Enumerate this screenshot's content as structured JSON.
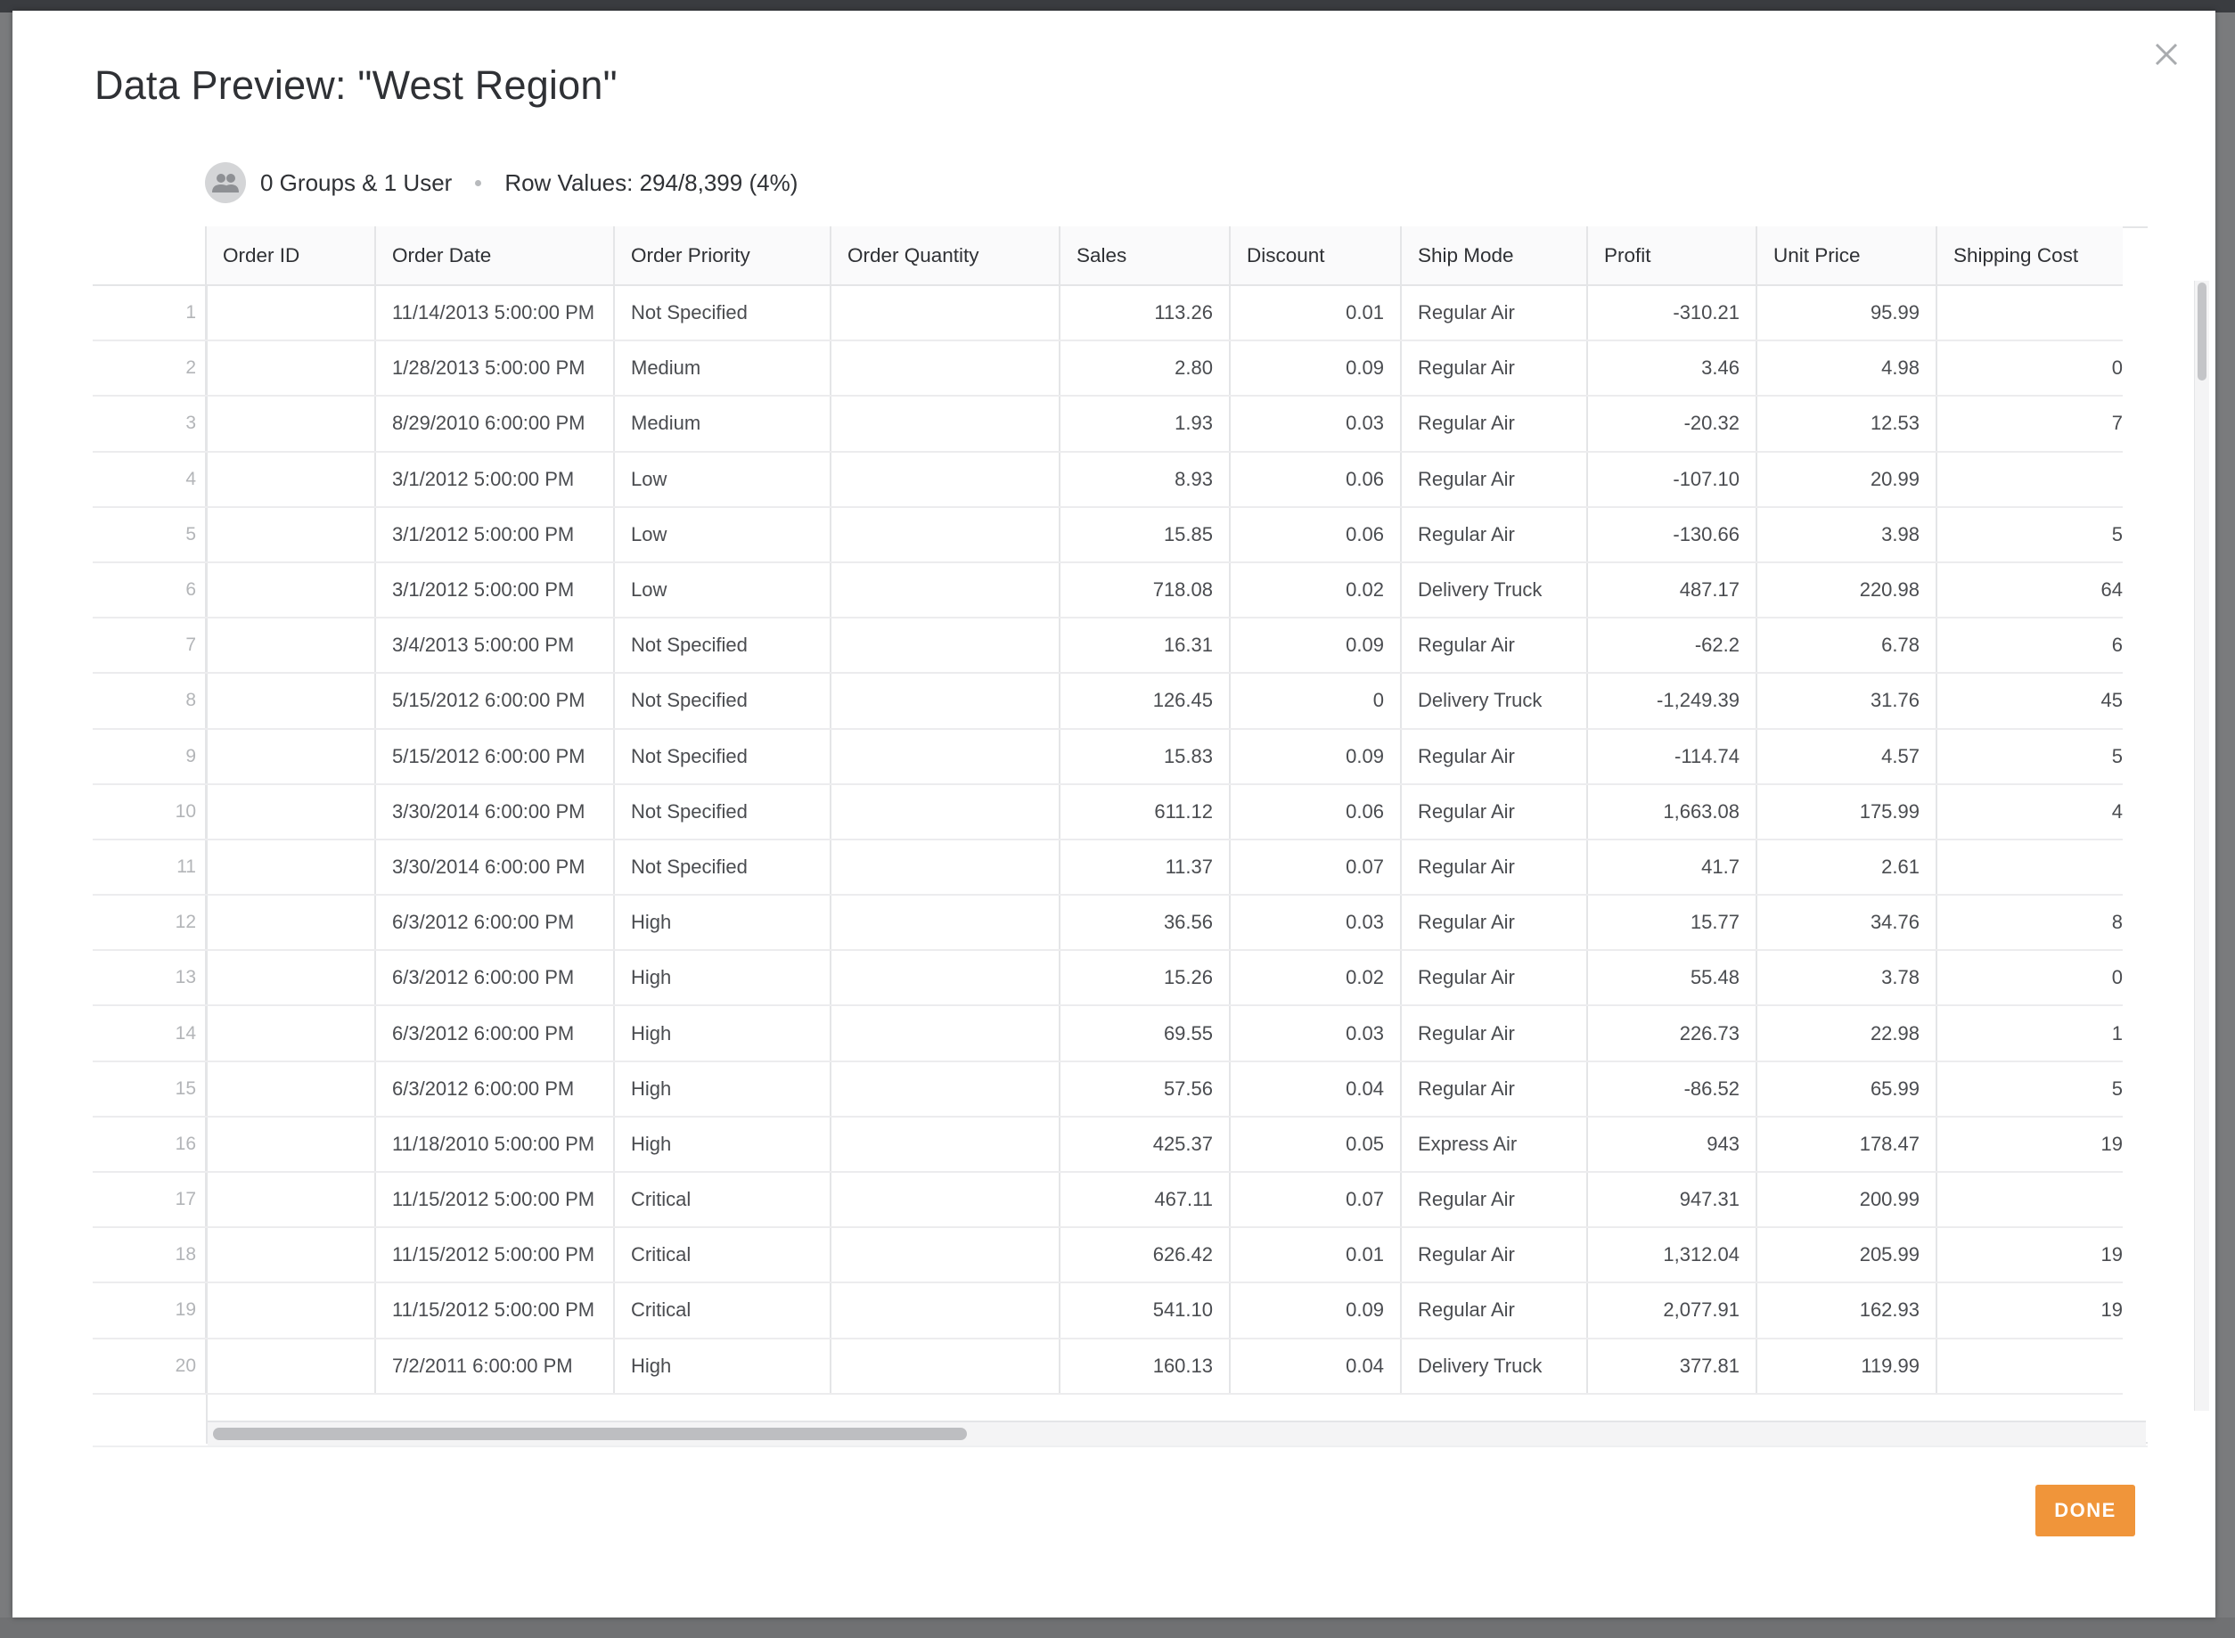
{
  "modal": {
    "title": "Data Preview: \"West Region\"",
    "access_summary": "0 Groups & 1 User",
    "row_values": "Row Values: 294/8,399 (4%)",
    "done_label": "DONE",
    "close_icon": "close-icon",
    "avatar_icon": "people-icon",
    "accent_color": "#f0953a"
  },
  "table": {
    "columns": [
      "Order ID",
      "Order Date",
      "Order Priority",
      "Order Quantity",
      "Sales",
      "Discount",
      "Ship Mode",
      "Profit",
      "Unit Price",
      "Shipping Cost"
    ],
    "rows": [
      {
        "n": "1",
        "order_id": "",
        "order_date": "11/14/2013 5:00:00 PM",
        "priority": "Not Specified",
        "quantity": "",
        "sales": "113.26",
        "discount": "0.01",
        "ship_mode": "Regular Air",
        "profit": "-310.21",
        "unit_price": "95.99",
        "shipping_cost": ""
      },
      {
        "n": "2",
        "order_id": "",
        "order_date": "1/28/2013 5:00:00 PM",
        "priority": "Medium",
        "quantity": "",
        "sales": "2.80",
        "discount": "0.09",
        "ship_mode": "Regular Air",
        "profit": "3.46",
        "unit_price": "4.98",
        "shipping_cost": "0"
      },
      {
        "n": "3",
        "order_id": "",
        "order_date": "8/29/2010 6:00:00 PM",
        "priority": "Medium",
        "quantity": "",
        "sales": "1.93",
        "discount": "0.03",
        "ship_mode": "Regular Air",
        "profit": "-20.32",
        "unit_price": "12.53",
        "shipping_cost": "7"
      },
      {
        "n": "4",
        "order_id": "",
        "order_date": "3/1/2012 5:00:00 PM",
        "priority": "Low",
        "quantity": "",
        "sales": "8.93",
        "discount": "0.06",
        "ship_mode": "Regular Air",
        "profit": "-107.10",
        "unit_price": "20.99",
        "shipping_cost": ""
      },
      {
        "n": "5",
        "order_id": "",
        "order_date": "3/1/2012 5:00:00 PM",
        "priority": "Low",
        "quantity": "",
        "sales": "15.85",
        "discount": "0.06",
        "ship_mode": "Regular Air",
        "profit": "-130.66",
        "unit_price": "3.98",
        "shipping_cost": "5"
      },
      {
        "n": "6",
        "order_id": "",
        "order_date": "3/1/2012 5:00:00 PM",
        "priority": "Low",
        "quantity": "",
        "sales": "718.08",
        "discount": "0.02",
        "ship_mode": "Delivery Truck",
        "profit": "487.17",
        "unit_price": "220.98",
        "shipping_cost": "64"
      },
      {
        "n": "7",
        "order_id": "",
        "order_date": "3/4/2013 5:00:00 PM",
        "priority": "Not Specified",
        "quantity": "",
        "sales": "16.31",
        "discount": "0.09",
        "ship_mode": "Regular Air",
        "profit": "-62.2",
        "unit_price": "6.78",
        "shipping_cost": "6"
      },
      {
        "n": "8",
        "order_id": "",
        "order_date": "5/15/2012 6:00:00 PM",
        "priority": "Not Specified",
        "quantity": "",
        "sales": "126.45",
        "discount": "0",
        "ship_mode": "Delivery Truck",
        "profit": "-1,249.39",
        "unit_price": "31.76",
        "shipping_cost": "45"
      },
      {
        "n": "9",
        "order_id": "",
        "order_date": "5/15/2012 6:00:00 PM",
        "priority": "Not Specified",
        "quantity": "",
        "sales": "15.83",
        "discount": "0.09",
        "ship_mode": "Regular Air",
        "profit": "-114.74",
        "unit_price": "4.57",
        "shipping_cost": "5"
      },
      {
        "n": "10",
        "order_id": "",
        "order_date": "3/30/2014 6:00:00 PM",
        "priority": "Not Specified",
        "quantity": "",
        "sales": "611.12",
        "discount": "0.06",
        "ship_mode": "Regular Air",
        "profit": "1,663.08",
        "unit_price": "175.99",
        "shipping_cost": "4"
      },
      {
        "n": "11",
        "order_id": "",
        "order_date": "3/30/2014 6:00:00 PM",
        "priority": "Not Specified",
        "quantity": "",
        "sales": "11.37",
        "discount": "0.07",
        "ship_mode": "Regular Air",
        "profit": "41.7",
        "unit_price": "2.61",
        "shipping_cost": ""
      },
      {
        "n": "12",
        "order_id": "",
        "order_date": "6/3/2012 6:00:00 PM",
        "priority": "High",
        "quantity": "",
        "sales": "36.56",
        "discount": "0.03",
        "ship_mode": "Regular Air",
        "profit": "15.77",
        "unit_price": "34.76",
        "shipping_cost": "8"
      },
      {
        "n": "13",
        "order_id": "",
        "order_date": "6/3/2012 6:00:00 PM",
        "priority": "High",
        "quantity": "",
        "sales": "15.26",
        "discount": "0.02",
        "ship_mode": "Regular Air",
        "profit": "55.48",
        "unit_price": "3.78",
        "shipping_cost": "0"
      },
      {
        "n": "14",
        "order_id": "",
        "order_date": "6/3/2012 6:00:00 PM",
        "priority": "High",
        "quantity": "",
        "sales": "69.55",
        "discount": "0.03",
        "ship_mode": "Regular Air",
        "profit": "226.73",
        "unit_price": "22.98",
        "shipping_cost": "1"
      },
      {
        "n": "15",
        "order_id": "",
        "order_date": "6/3/2012 6:00:00 PM",
        "priority": "High",
        "quantity": "",
        "sales": "57.56",
        "discount": "0.04",
        "ship_mode": "Regular Air",
        "profit": "-86.52",
        "unit_price": "65.99",
        "shipping_cost": "5"
      },
      {
        "n": "16",
        "order_id": "",
        "order_date": "11/18/2010 5:00:00 PM",
        "priority": "High",
        "quantity": "",
        "sales": "425.37",
        "discount": "0.05",
        "ship_mode": "Express Air",
        "profit": "943",
        "unit_price": "178.47",
        "shipping_cost": "19"
      },
      {
        "n": "17",
        "order_id": "",
        "order_date": "11/15/2012 5:00:00 PM",
        "priority": "Critical",
        "quantity": "",
        "sales": "467.11",
        "discount": "0.07",
        "ship_mode": "Regular Air",
        "profit": "947.31",
        "unit_price": "200.99",
        "shipping_cost": ""
      },
      {
        "n": "18",
        "order_id": "",
        "order_date": "11/15/2012 5:00:00 PM",
        "priority": "Critical",
        "quantity": "",
        "sales": "626.42",
        "discount": "0.01",
        "ship_mode": "Regular Air",
        "profit": "1,312.04",
        "unit_price": "205.99",
        "shipping_cost": "19"
      },
      {
        "n": "19",
        "order_id": "",
        "order_date": "11/15/2012 5:00:00 PM",
        "priority": "Critical",
        "quantity": "",
        "sales": "541.10",
        "discount": "0.09",
        "ship_mode": "Regular Air",
        "profit": "2,077.91",
        "unit_price": "162.93",
        "shipping_cost": "19"
      },
      {
        "n": "20",
        "order_id": "",
        "order_date": "7/2/2011 6:00:00 PM",
        "priority": "High",
        "quantity": "",
        "sales": "160.13",
        "discount": "0.04",
        "ship_mode": "Delivery Truck",
        "profit": "377.81",
        "unit_price": "119.99",
        "shipping_cost": ""
      }
    ]
  }
}
